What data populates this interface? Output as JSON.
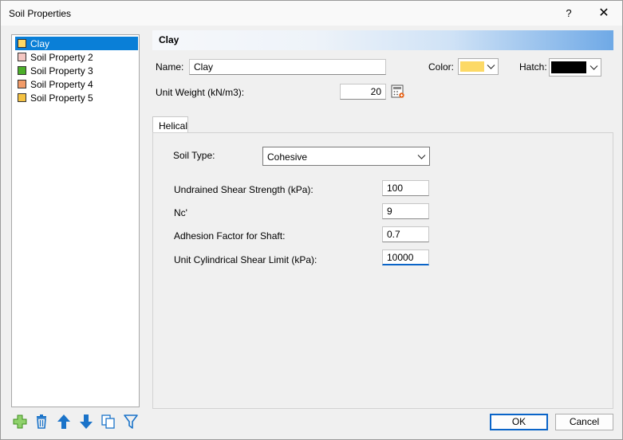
{
  "window": {
    "title": "Soil Properties",
    "help_glyph": "?",
    "close_glyph": "✕"
  },
  "soil_list": {
    "items": [
      {
        "label": "Clay",
        "color": "#fcd966",
        "selected": true
      },
      {
        "label": "Soil Property 2",
        "color": "#f4c7c3"
      },
      {
        "label": "Soil Property 3",
        "color": "#4caf2a"
      },
      {
        "label": "Soil Property 4",
        "color": "#f29b68"
      },
      {
        "label": "Soil Property 5",
        "color": "#f5c242"
      }
    ]
  },
  "toolbar": {
    "icons": [
      "add-icon",
      "delete-icon",
      "move-up-icon",
      "move-down-icon",
      "copy-icon",
      "filter-icon"
    ],
    "accent": "#4caf2a",
    "icon_color": "#1a73c9"
  },
  "properties": {
    "header_title": "Clay",
    "name_label": "Name:",
    "name_value": "Clay",
    "color_label": "Color:",
    "color_value": "#fcd966",
    "hatch_label": "Hatch:",
    "hatch_value": "#000000",
    "unit_weight_label": "Unit Weight (kN/m3):",
    "unit_weight_value": "20"
  },
  "tabs": [
    {
      "label": "Helical",
      "active": true
    }
  ],
  "helical": {
    "soil_type_label": "Soil Type:",
    "soil_type_value": "Cohesive",
    "undrained_label": "Undrained Shear Strength (kPa):",
    "undrained_value": "100",
    "nc_label": "Nc'",
    "nc_value": "9",
    "adhesion_label": "Adhesion Factor for Shaft:",
    "adhesion_value": "0.7",
    "cyl_label": "Unit Cylindrical Shear Limit (kPa):",
    "cyl_value": "10000"
  },
  "buttons": {
    "ok": "OK",
    "cancel": "Cancel"
  }
}
